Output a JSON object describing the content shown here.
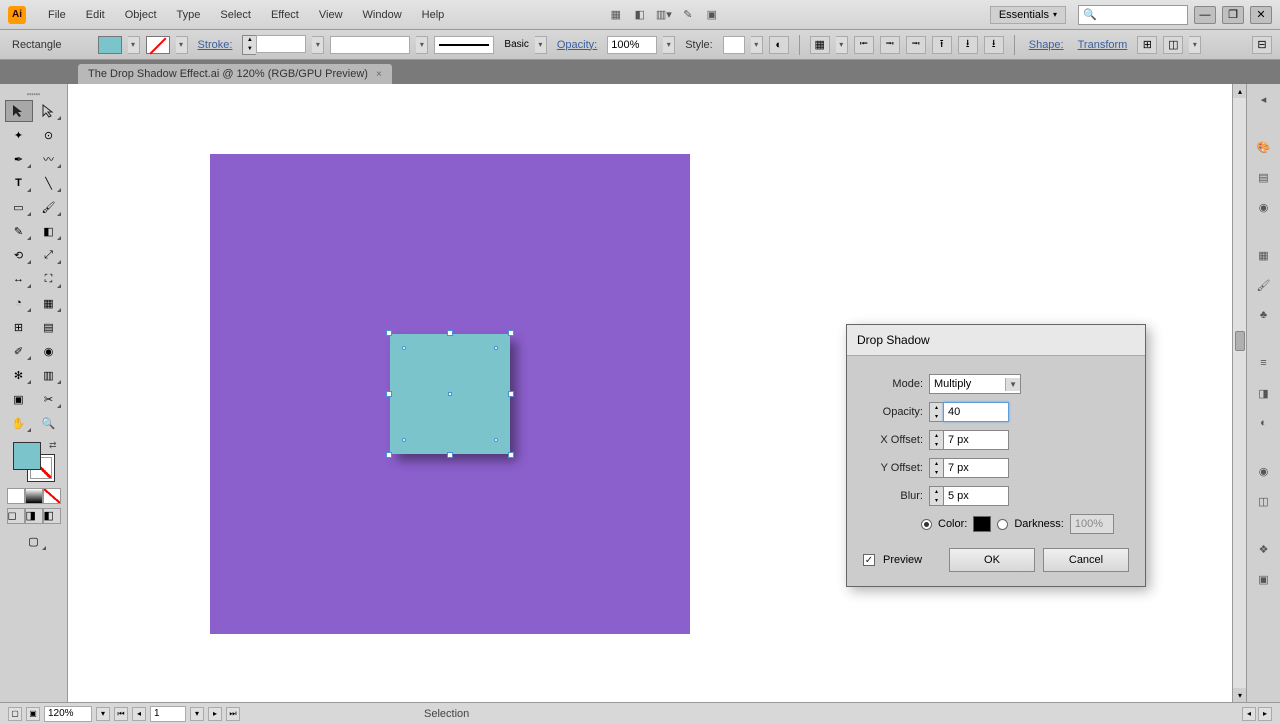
{
  "menu": {
    "file": "File",
    "edit": "Edit",
    "object": "Object",
    "type": "Type",
    "select": "Select",
    "effect": "Effect",
    "view": "View",
    "window": "Window",
    "help": "Help"
  },
  "workspace": "Essentials",
  "control": {
    "shape_label": "Rectangle",
    "stroke_label": "Stroke:",
    "stroke_weight": "",
    "profile": "Basic",
    "opacity_label": "Opacity:",
    "opacity_value": "100%",
    "style_label": "Style:",
    "shape_link": "Shape:",
    "transform_link": "Transform"
  },
  "doc_tab": {
    "title": "The Drop Shadow Effect.ai @ 120% (RGB/GPU Preview)",
    "close": "×"
  },
  "dialog": {
    "title": "Drop Shadow",
    "mode_label": "Mode:",
    "mode_value": "Multiply",
    "opacity_label": "Opacity:",
    "opacity_value": "40",
    "xoffset_label": "X Offset:",
    "xoffset_value": "7 px",
    "yoffset_label": "Y Offset:",
    "yoffset_value": "7 px",
    "blur_label": "Blur:",
    "blur_value": "5 px",
    "color_label": "Color:",
    "darkness_label": "Darkness:",
    "darkness_value": "100%",
    "preview_label": "Preview",
    "ok": "OK",
    "cancel": "Cancel"
  },
  "status": {
    "zoom": "120%",
    "page": "1",
    "tool": "Selection"
  }
}
